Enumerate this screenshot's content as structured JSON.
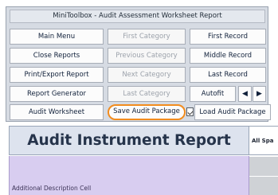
{
  "toolbox": {
    "title": "MiniToolbox - Audit Assessment Worksheet Report",
    "buttons": {
      "main_menu": "Main Menu",
      "first_category": "First Category",
      "first_record": "First Record",
      "close_reports": "Close Reports",
      "previous_category": "Previous Category",
      "middle_record": "Middle Record",
      "print_export_report": "Print/Export Report",
      "next_category": "Next Category",
      "last_record": "Last Record",
      "report_generator": "Report Generator",
      "last_category": "Last Category",
      "autofit": "Autofit",
      "prev_arrow": "◀",
      "next_arrow": "▶",
      "audit_worksheet": "Audit Worksheet",
      "save_audit_package": "Save Audit Package",
      "load_audit_package": "Load Audit Package"
    },
    "highlight_color": "#f28c1e"
  },
  "report": {
    "title": "Audit Instrument Report",
    "side_header": "All Spa",
    "description_label": "Additional Description Cell"
  }
}
